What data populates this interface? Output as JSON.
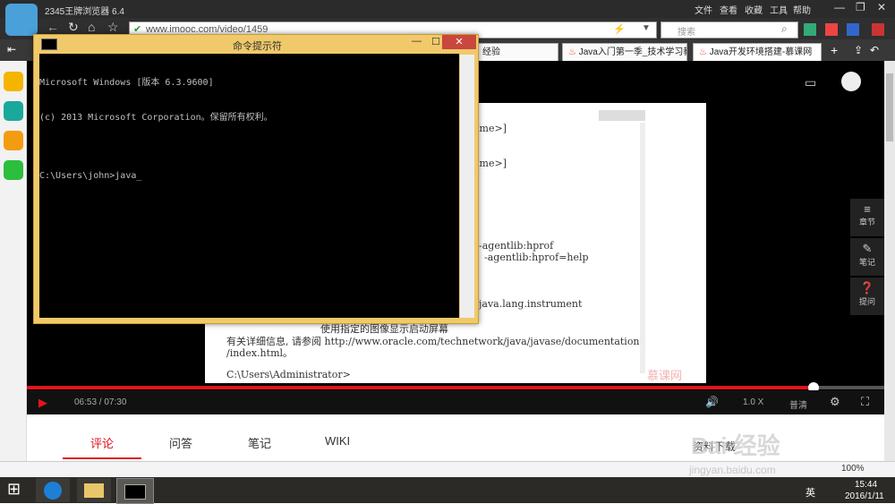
{
  "browser": {
    "title": "2345王牌浏览器 6.4",
    "address": "www.imooc.com/video/1459",
    "search_placeholder": "搜索",
    "menus": [
      "文件",
      "查看",
      "收藏",
      "工具",
      "帮助"
    ],
    "tabs": [
      {
        "label": "经验"
      },
      {
        "label": "Java入门第一季_技术学习教"
      },
      {
        "label": "Java开发环境搭建-慕课网"
      }
    ],
    "zoom": "100%"
  },
  "cmd": {
    "title": "命令提示符",
    "lines": [
      "Microsoft Windows [版本 6.3.9600]",
      "(c) 2013 Microsoft Corporation。保留所有权利。",
      "",
      "C:\\Users\\john>java"
    ]
  },
  "video_text": {
    "l1": "ame>]",
    "l2": "ame>]",
    "l3": "-agentlib:hprof",
    "l4": "-agentlib:hprof=help",
    "l5": "java.lang.instrument",
    "l6": "使用指定的图像显示启动屏幕",
    "l7": "有关详细信息, 请参阅 http://www.oracle.com/technetwork/java/javase/documentation",
    "l8": "/index.html。",
    "l9": "C:\\Users\\Administrator>",
    "watermark": "慕课网"
  },
  "player": {
    "time": "06:53 / 07:30",
    "progress": 0.888,
    "speed": "1.0 X",
    "quality": "普清",
    "side_buttons": [
      "章节",
      "笔记",
      "提问"
    ]
  },
  "subtabs": [
    "评论",
    "问答",
    "笔记",
    "WIKI"
  ],
  "extra": {
    "corner_text": "资料下载"
  },
  "taskbar": {
    "time": "15:44",
    "date": "2016/1/11",
    "ime": "英"
  },
  "watermark": {
    "text": "Bai 经验",
    "sub": "jingyan.baidu.com"
  }
}
